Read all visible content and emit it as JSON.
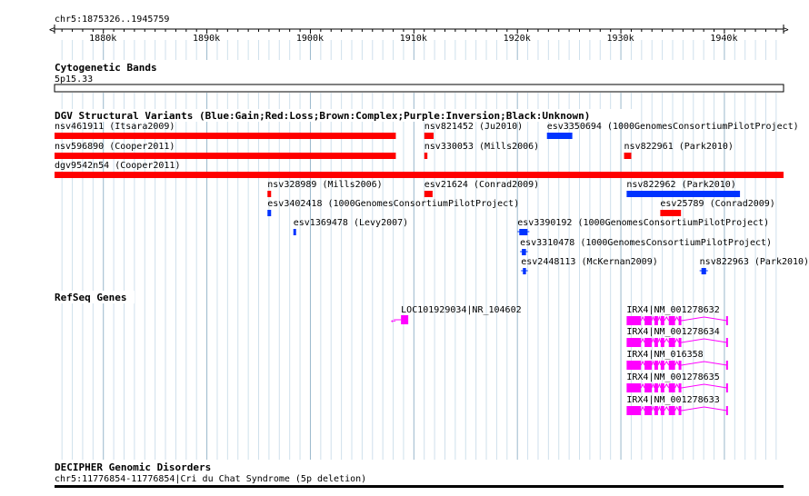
{
  "region": {
    "label": "chr5:1875326..1945759",
    "start": 1875326,
    "end": 1945759
  },
  "ruler": {
    "ticks": [
      "1880k",
      "1890k",
      "1900k",
      "1910k",
      "1920k",
      "1930k",
      "1940k"
    ]
  },
  "tracks": {
    "cytoband": {
      "title": "Cytogenetic Bands",
      "band": "5p15.33"
    },
    "dgv": {
      "title": "DGV Structural Variants (Blue:Gain;Red:Loss;Brown:Complex;Purple:Inversion;Black:Unknown)",
      "colors": {
        "gain": "#0033ff",
        "loss": "#ff0000"
      },
      "features": [
        {
          "label": "nsv461911 (Itsara2009)",
          "type": "loss",
          "start": 1875326,
          "end": 1908300
        },
        {
          "label": "nsv821452 (Ju2010)",
          "type": "loss",
          "start": 1911050,
          "end": 1911950
        },
        {
          "label": "esv3350694 (1000GenomesConsortiumPilotProject)",
          "type": "gain",
          "start": 1922900,
          "end": 1925350
        },
        {
          "label": "nsv596890 (Cooper2011)",
          "type": "loss",
          "start": 1875326,
          "end": 1908300
        },
        {
          "label": "nsv330053 (Mills2006)",
          "type": "loss",
          "start": 1911050,
          "end": 1911350
        },
        {
          "label": "nsv822961 (Park2010)",
          "type": "loss",
          "start": 1930350,
          "end": 1931050
        },
        {
          "label": "dgv9542n54 (Cooper2011)",
          "type": "loss",
          "start": 1875326,
          "end": 1945759
        },
        {
          "label": "nsv328989 (Mills2006)",
          "type": "loss",
          "start": 1895900,
          "end": 1896250
        },
        {
          "label": "esv21624 (Conrad2009)",
          "type": "loss",
          "start": 1911050,
          "end": 1911850
        },
        {
          "label": "nsv822962 (Park2010)",
          "type": "gain",
          "start": 1930600,
          "end": 1941550
        },
        {
          "label": "esv3402418 (1000GenomesConsortiumPilotProject)",
          "type": "gain",
          "start": 1895900,
          "end": 1896250
        },
        {
          "label": "esv25789 (Conrad2009)",
          "type": "loss",
          "start": 1933850,
          "end": 1935850
        },
        {
          "label": "esv1369478 (Levy2007)",
          "type": "gain",
          "start": 1898400,
          "end": 1898550
        },
        {
          "label": "esv3390192 (1000GenomesConsortiumPilotProject)",
          "type": "gain",
          "start": 1920050,
          "end": 1921200
        },
        {
          "label": "esv3310478 (1000GenomesConsortiumPilotProject)",
          "type": "gain",
          "start": 1920300,
          "end": 1921050
        },
        {
          "label": "esv2448113 (McKernan2009)",
          "type": "gain",
          "start": 1920400,
          "end": 1921050
        },
        {
          "label": "nsv822963 (Park2010)",
          "type": "gain",
          "start": 1937650,
          "end": 1938450
        }
      ]
    },
    "refseq": {
      "title": "RefSeq Genes",
      "color": "#ff00ff",
      "genes": [
        {
          "label": "LOC101929034|NR_104602",
          "strand": "-",
          "start": 1908800,
          "end": 1909500
        },
        {
          "label": "IRX4|NM_001278632",
          "strand": "-",
          "start": 1930600,
          "end": 1940300
        },
        {
          "label": "IRX4|NM_001278634",
          "strand": "-",
          "start": 1930600,
          "end": 1940300
        },
        {
          "label": "IRX4|NM_016358",
          "strand": "-",
          "start": 1930600,
          "end": 1940300
        },
        {
          "label": "IRX4|NM_001278635",
          "strand": "-",
          "start": 1930600,
          "end": 1940300
        },
        {
          "label": "IRX4|NM_001278633",
          "strand": "-",
          "start": 1930600,
          "end": 1940300
        }
      ]
    },
    "decipher": {
      "title": "DECIPHER Genomic Disorders",
      "feature": "chr5:11776854-11776854|Cri du Chat Syndrome (5p deletion)"
    }
  }
}
